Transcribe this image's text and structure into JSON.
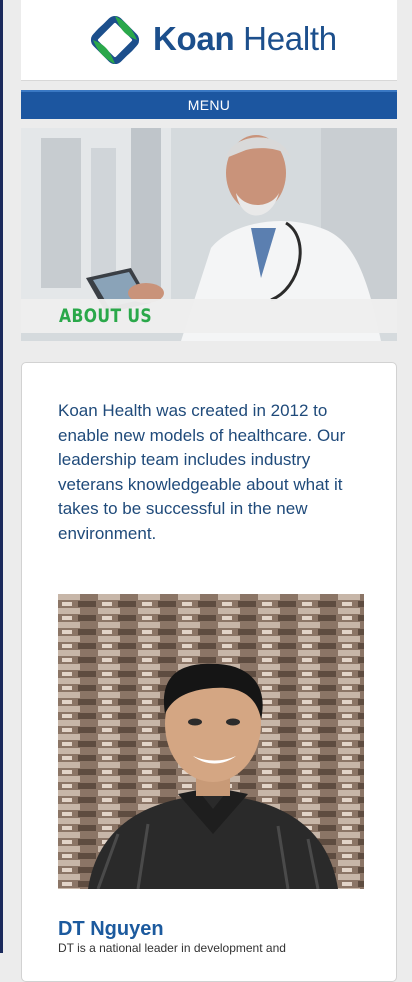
{
  "header": {
    "brand_bold": "Koan",
    "brand_light": " Health"
  },
  "nav": {
    "menu_label": "MENU"
  },
  "hero": {
    "caption": "ABOUT US"
  },
  "about": {
    "intro": "Koan Health was created in 2012 to enable new models of healthcare. Our leadership team includes industry veterans knowledgeable about what it takes to be successful in the new environment.",
    "person": {
      "name": "DT Nguyen",
      "bio": "DT is a national leader in development and"
    }
  },
  "colors": {
    "brand_blue": "#1c4f8c",
    "menu_blue": "#1c56a0",
    "accent_green": "#2aa84a",
    "text_blue": "#1f4a7a"
  }
}
